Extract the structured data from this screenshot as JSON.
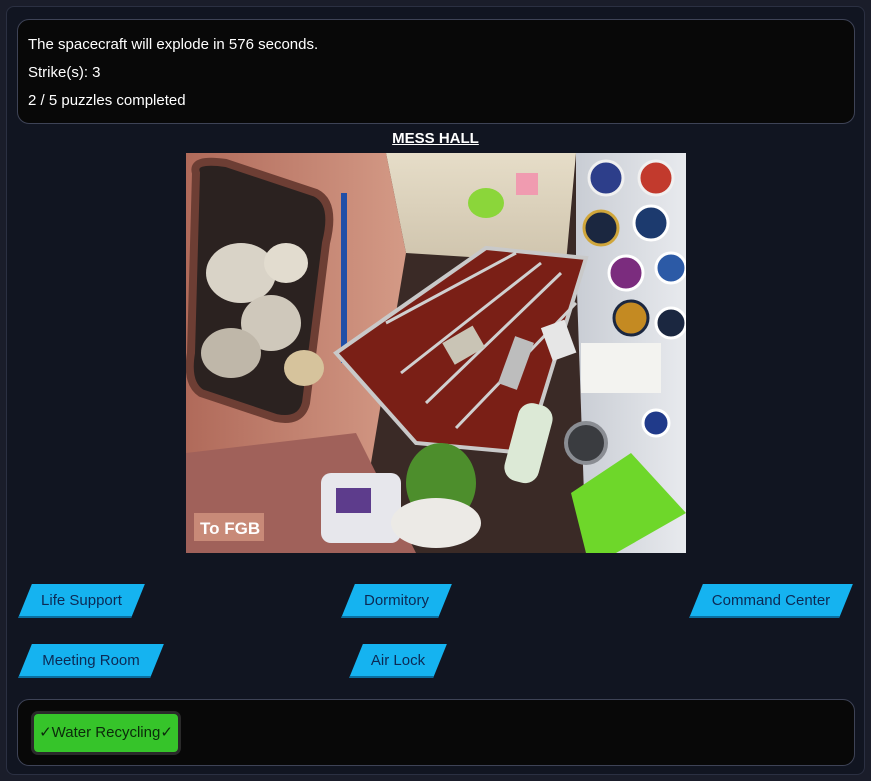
{
  "status": {
    "timer_text": "The spacecraft will explode in 576 seconds.",
    "strikes_text": "Strike(s): 3",
    "progress_text": "2 / 5 puzzles completed",
    "seconds_remaining": 576,
    "strikes": 3,
    "puzzles_completed": 2,
    "puzzles_total": 5
  },
  "room": {
    "title": "MESS HALL",
    "photo_sign_text": "To FGB"
  },
  "navigation": [
    {
      "label": "Life Support"
    },
    {
      "label": "Dormitory"
    },
    {
      "label": "Command Center"
    },
    {
      "label": "Meeting Room"
    },
    {
      "label": "Air Lock"
    }
  ],
  "inventory": {
    "items": [
      {
        "label": "✓Water Recycling✓",
        "color": "#36c42a"
      }
    ]
  },
  "colors": {
    "nav_button": "#15b3f0",
    "nav_text": "#0c2a55",
    "panel_bg": "#080808",
    "page_bg": "#111521"
  }
}
